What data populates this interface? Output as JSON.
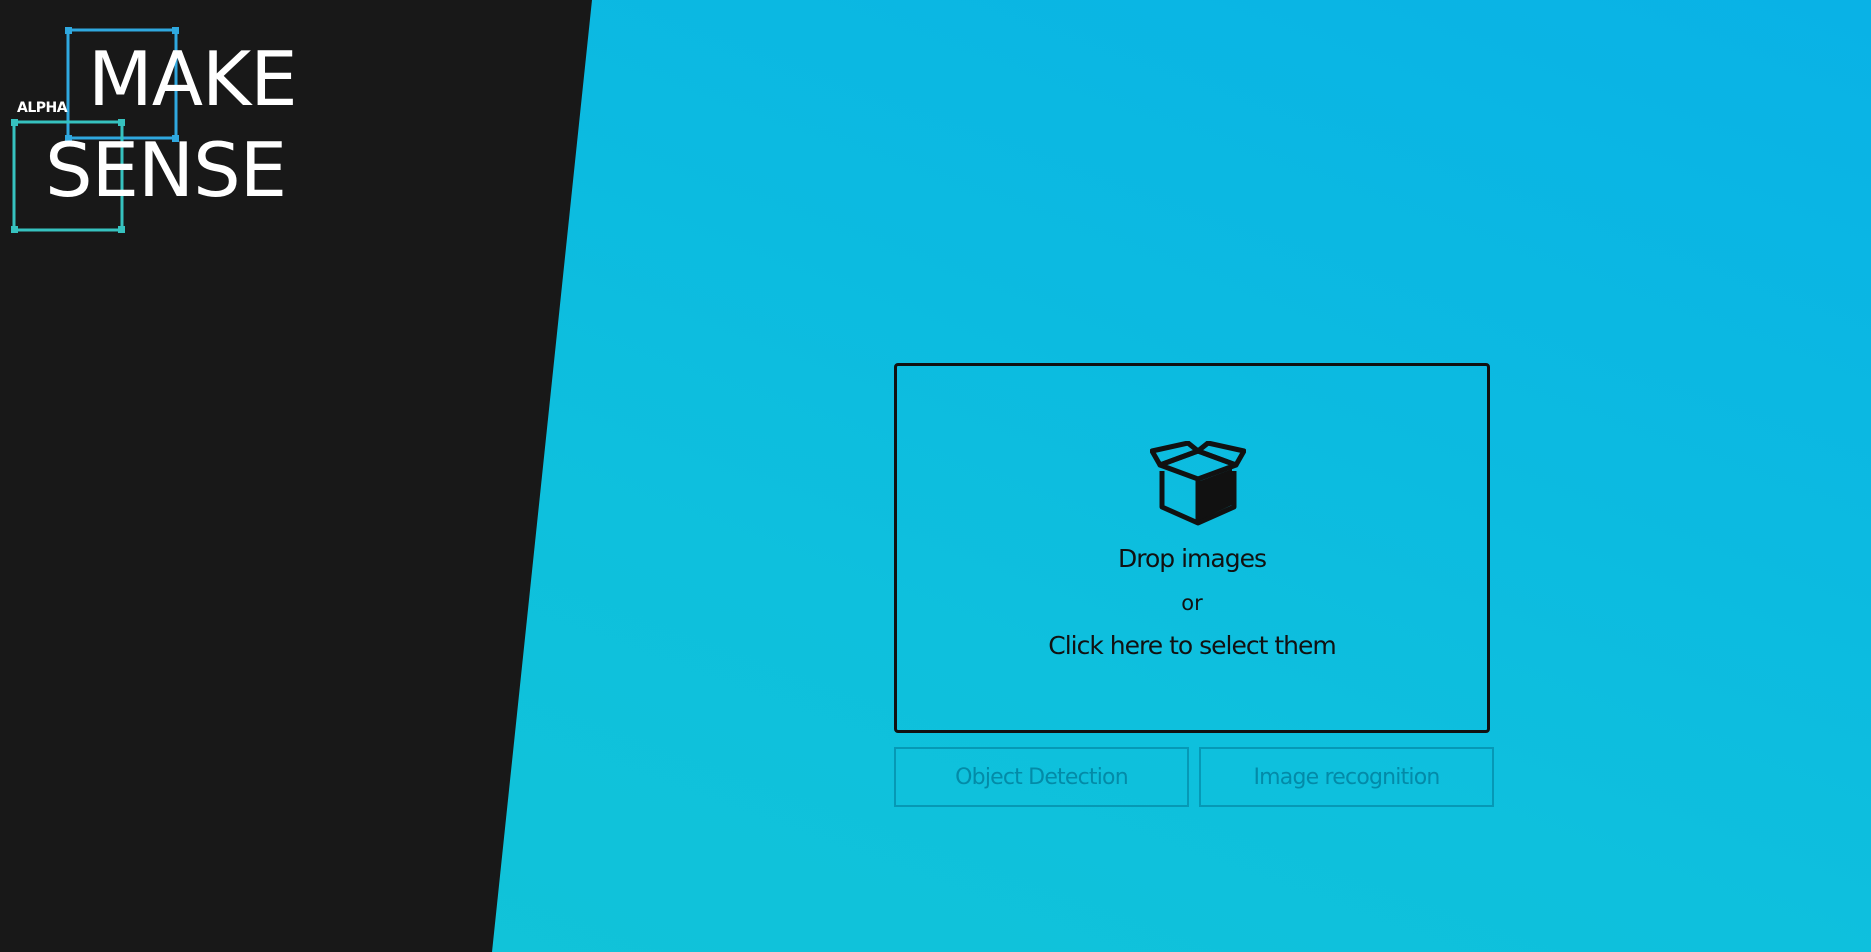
{
  "logo": {
    "line1": "MAKE",
    "line2": "SENSE",
    "badge": "ALPHA",
    "colors": {
      "upper_frame": "#2fa8df",
      "lower_frame": "#36c2bf"
    }
  },
  "dropzone": {
    "icon": "box-open-icon",
    "title": "Drop images",
    "separator": "or",
    "action": "Click here to select them"
  },
  "modes": {
    "object_detection": "Object Detection",
    "image_recognition": "Image recognition"
  },
  "colors": {
    "left_panel": "#181818",
    "background_accent": "#0bb8e2",
    "text_dark": "#111111"
  }
}
